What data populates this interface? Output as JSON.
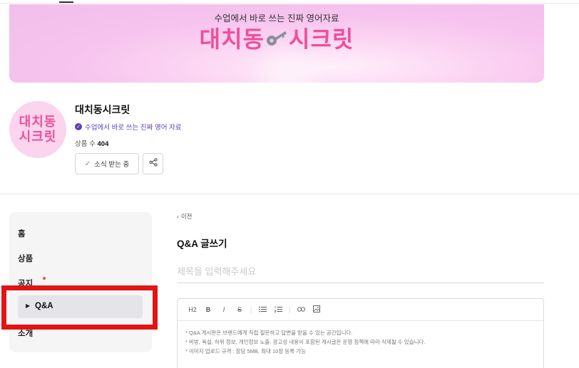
{
  "banner": {
    "subtitle": "수업에서 바로 쓰는 진짜 영어자료",
    "title_left": "대치동",
    "title_right": "시크릿"
  },
  "profile": {
    "avatar_line1": "대치동",
    "avatar_line2": "시크릿",
    "name": "대치동시크릿",
    "tagline": "수업에서 바로 쓰는 진짜 영어 자료",
    "product_count_label": "상품 수",
    "product_count": "404",
    "follow_label": "소식 받는 중"
  },
  "sidebar": {
    "items": [
      {
        "label": "홈"
      },
      {
        "label": "상품"
      },
      {
        "label": "공지"
      },
      {
        "label": "Q&A",
        "active": true
      },
      {
        "label": "소개"
      }
    ]
  },
  "form": {
    "back_label": "이전",
    "page_title": "Q&A 글쓰기",
    "title_placeholder": "제목을 입력해주세요",
    "toolbar": [
      "H2",
      "B",
      "I",
      "S",
      "bullet-list",
      "numbered-list",
      "link",
      "image"
    ],
    "hints": [
      "* Q&A 게시판은 브랜드에게 직접 질문하고 답변을 받을 수 있는 공간입니다.",
      "* 비방, 욕설, 허위 정보, 개인정보 노출, 광고성 내용이 포함된 게시글은 운영 정책에 따라 삭제될 수 있습니다.",
      "* 이미지 업로드 규격 : 장당 5MB, 최대 10장 등록 가능"
    ]
  },
  "colors": {
    "brand_pink": "#ee4f9a",
    "accent_purple": "#5b3fb5",
    "highlight_red": "#e21414"
  }
}
